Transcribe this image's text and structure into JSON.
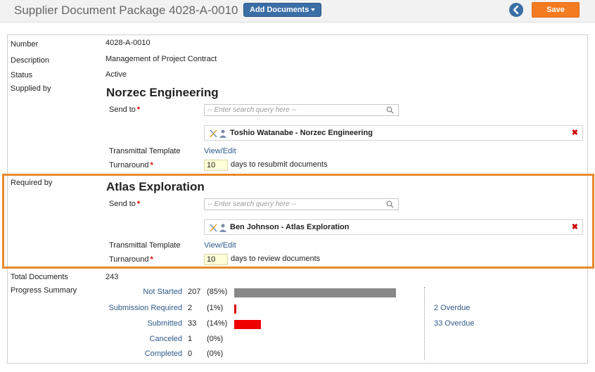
{
  "header": {
    "title": "Supplier Document Package 4028-A-0010",
    "add_documents_label": "Add Documents",
    "save_label": "Save"
  },
  "fields": {
    "number_label": "Number",
    "number_value": "4028-A-0010",
    "description_label": "Description",
    "description_value": "Management of Project Contract",
    "status_label": "Status",
    "status_value": "Active",
    "supplied_by_label": "Supplied by",
    "required_by_label": "Required by",
    "total_documents_label": "Total Documents",
    "total_documents_value": "243",
    "progress_summary_label": "Progress Summary"
  },
  "supplied_by": {
    "company": "Norzec Engineering",
    "send_to_label": "Send to",
    "search_placeholder": "-- Enter search query here --",
    "recipient": "Toshio Watanabe - Norzec Engineering",
    "transmittal_label": "Transmittal Template",
    "transmittal_link": "View/Edit",
    "turnaround_label": "Turnaround",
    "turnaround_value": "10",
    "turnaround_suffix": "days to resubmit documents"
  },
  "required_by": {
    "company": "Atlas Exploration",
    "send_to_label": "Send to",
    "search_placeholder": "-- Enter search query here --",
    "recipient": "Ben Johnson - Atlas Exploration",
    "transmittal_label": "Transmittal Template",
    "transmittal_link": "View/Edit",
    "turnaround_label": "Turnaround",
    "turnaround_value": "10",
    "turnaround_suffix": "days to review documents"
  },
  "progress": [
    {
      "label": "Not Started",
      "count": "207",
      "pct": "(85%)",
      "fraction": 0.85,
      "color": "#888888",
      "overdue": ""
    },
    {
      "label": "Submission Required",
      "count": "2",
      "pct": "(1%)",
      "fraction": 0.01,
      "color": "#dd0000",
      "overdue": "2 Overdue"
    },
    {
      "label": "Submitted",
      "count": "33",
      "pct": "(14%)",
      "fraction": 0.14,
      "color": "#ee0000",
      "overdue": "33 Overdue"
    },
    {
      "label": "Canceled",
      "count": "1",
      "pct": "(0%)",
      "fraction": 0,
      "color": "#888888",
      "overdue": ""
    },
    {
      "label": "Completed",
      "count": "0",
      "pct": "(0%)",
      "fraction": 0,
      "color": "#888888",
      "overdue": ""
    }
  ],
  "icons": {
    "back": "chevron-left-icon",
    "search": "search-icon",
    "people": "people-icon",
    "remove": "close-icon"
  },
  "colors": {
    "save_button": "#f47c20",
    "primary_button": "#3b6ea5",
    "highlight_border": "#e88a2c",
    "link": "#2e5a8a",
    "required_star": "#dd0000"
  }
}
